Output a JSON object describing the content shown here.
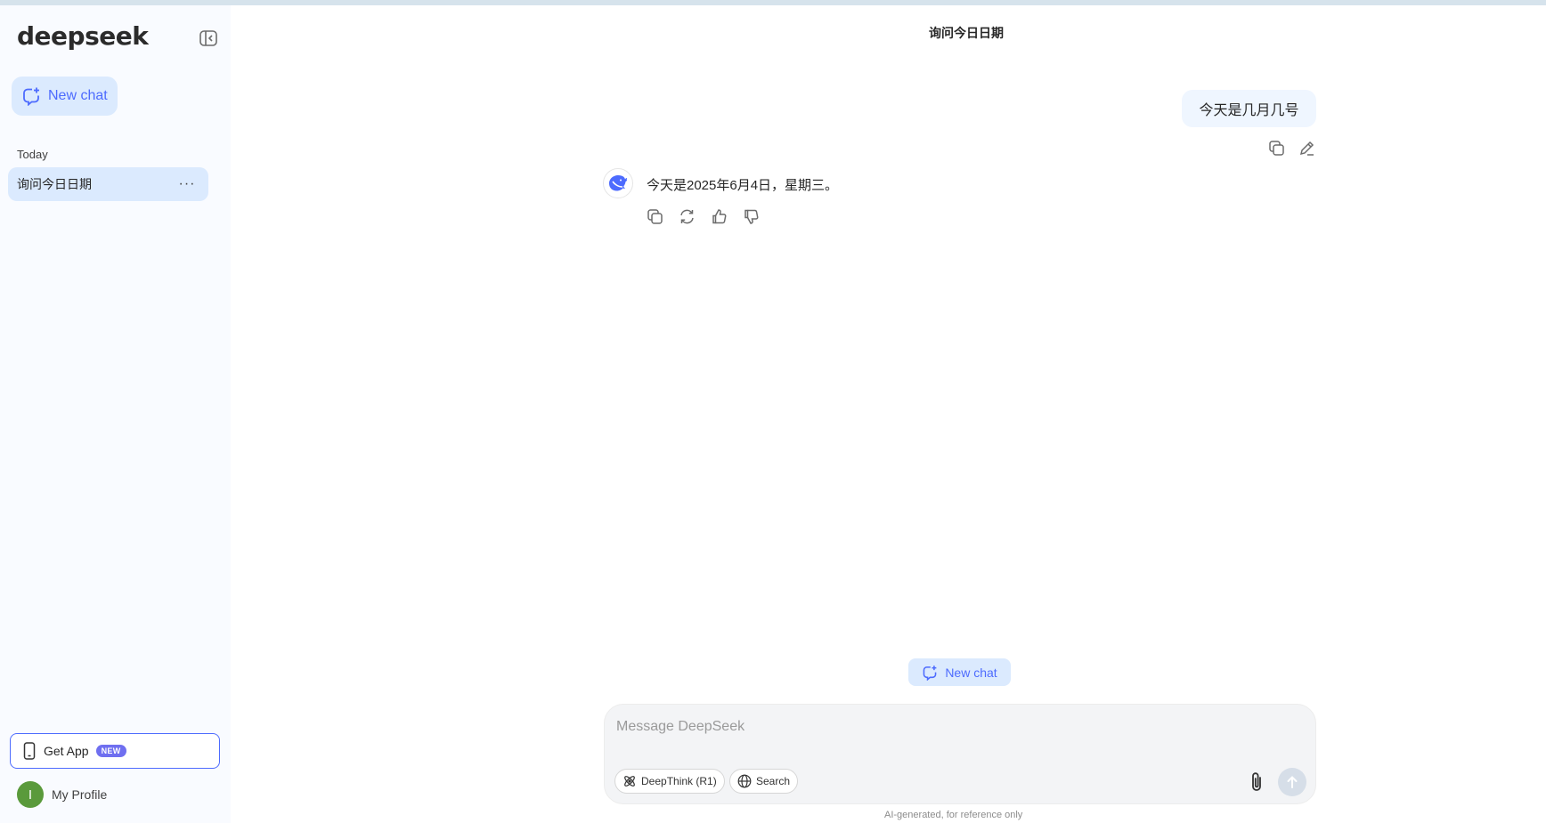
{
  "app": {
    "logo_text": "deepseek",
    "accent_color": "#4d6bfe"
  },
  "sidebar": {
    "new_chat_label": "New chat",
    "section_today": "Today",
    "history": [
      {
        "label": "询问今日日期",
        "more": "···"
      }
    ],
    "get_app_label": "Get App",
    "get_app_badge": "NEW",
    "profile": {
      "initial": "I",
      "label": "My Profile"
    }
  },
  "chat": {
    "title": "询问今日日期",
    "user_message": "今天是几月几号",
    "assistant_message": "今天是2025年6月4日，星期三。",
    "new_chat_pill": "New chat"
  },
  "composer": {
    "placeholder": "Message DeepSeek",
    "value": "",
    "deepthink_label": "DeepThink (R1)",
    "search_label": "Search"
  },
  "footer": {
    "disclaimer": "AI-generated, for reference only"
  }
}
